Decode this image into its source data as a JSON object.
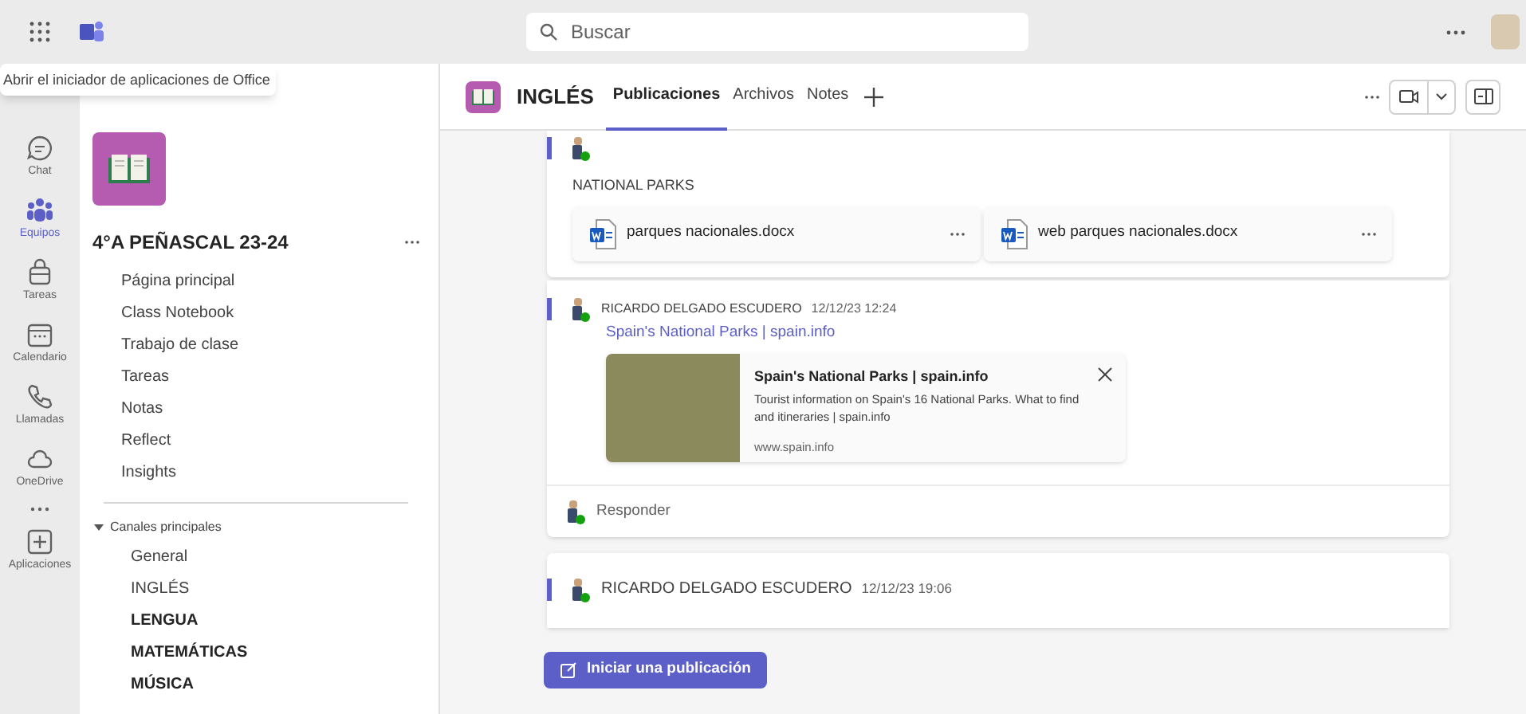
{
  "top_bar": {
    "search_placeholder": "Buscar"
  },
  "tooltip": "Abrir el iniciador de aplicaciones de Office",
  "rail": [
    {
      "label": "Chat",
      "selected": false
    },
    {
      "label": "Equipos",
      "selected": true
    },
    {
      "label": "Tareas",
      "selected": false
    },
    {
      "label": "Calendario",
      "selected": false
    },
    {
      "label": "Llamadas",
      "selected": false
    },
    {
      "label": "OneDrive",
      "selected": false
    },
    {
      "selected": false
    },
    {
      "label": "Aplicaciones",
      "selected": false
    }
  ],
  "team": {
    "name": "4°A PEÑASCAL 23-24",
    "nav": [
      "Página principal",
      "Class Notebook",
      "Trabajo de clase",
      "Tareas",
      "Notas",
      "Reflect",
      "Insights"
    ],
    "channels_heading": "Canales principales",
    "channels_expanded": true,
    "channels": [
      {
        "name": "General",
        "unread": false
      },
      {
        "name": "INGLÉS",
        "unread": false
      },
      {
        "name": "LENGUA",
        "unread": true
      },
      {
        "name": "MATEMÁTICAS",
        "unread": true
      },
      {
        "name": "MÚSICA",
        "unread": true
      }
    ]
  },
  "channel_header": {
    "name": "INGLÉS",
    "tabs": [
      {
        "label": "Publicaciones",
        "selected": true
      },
      {
        "label": "Archivos",
        "selected": false
      },
      {
        "label": "Notes",
        "selected": false
      }
    ]
  },
  "posts": [
    {
      "kind": "files",
      "subject": "NATIONAL PARKS",
      "files": [
        "parques nacionales.docx",
        "web parques nacionales.docx"
      ]
    },
    {
      "kind": "link",
      "author": "RICARDO DELGADO ESCUDERO",
      "time": "12/12/23 12:24",
      "link": "Spain's National Parks | spain.info",
      "preview": {
        "title": "Spain's National Parks | spain.info",
        "description": "Tourist information on Spain's 16 National Parks. What to find and itineraries | spain.info",
        "url": "www.spain.info"
      },
      "reply": "Responder"
    },
    {
      "kind": "header",
      "author": "RICARDO DELGADO ESCUDERO",
      "time": "12/12/23 19:06"
    }
  ],
  "new_post_button": "Iniciar una publicación"
}
